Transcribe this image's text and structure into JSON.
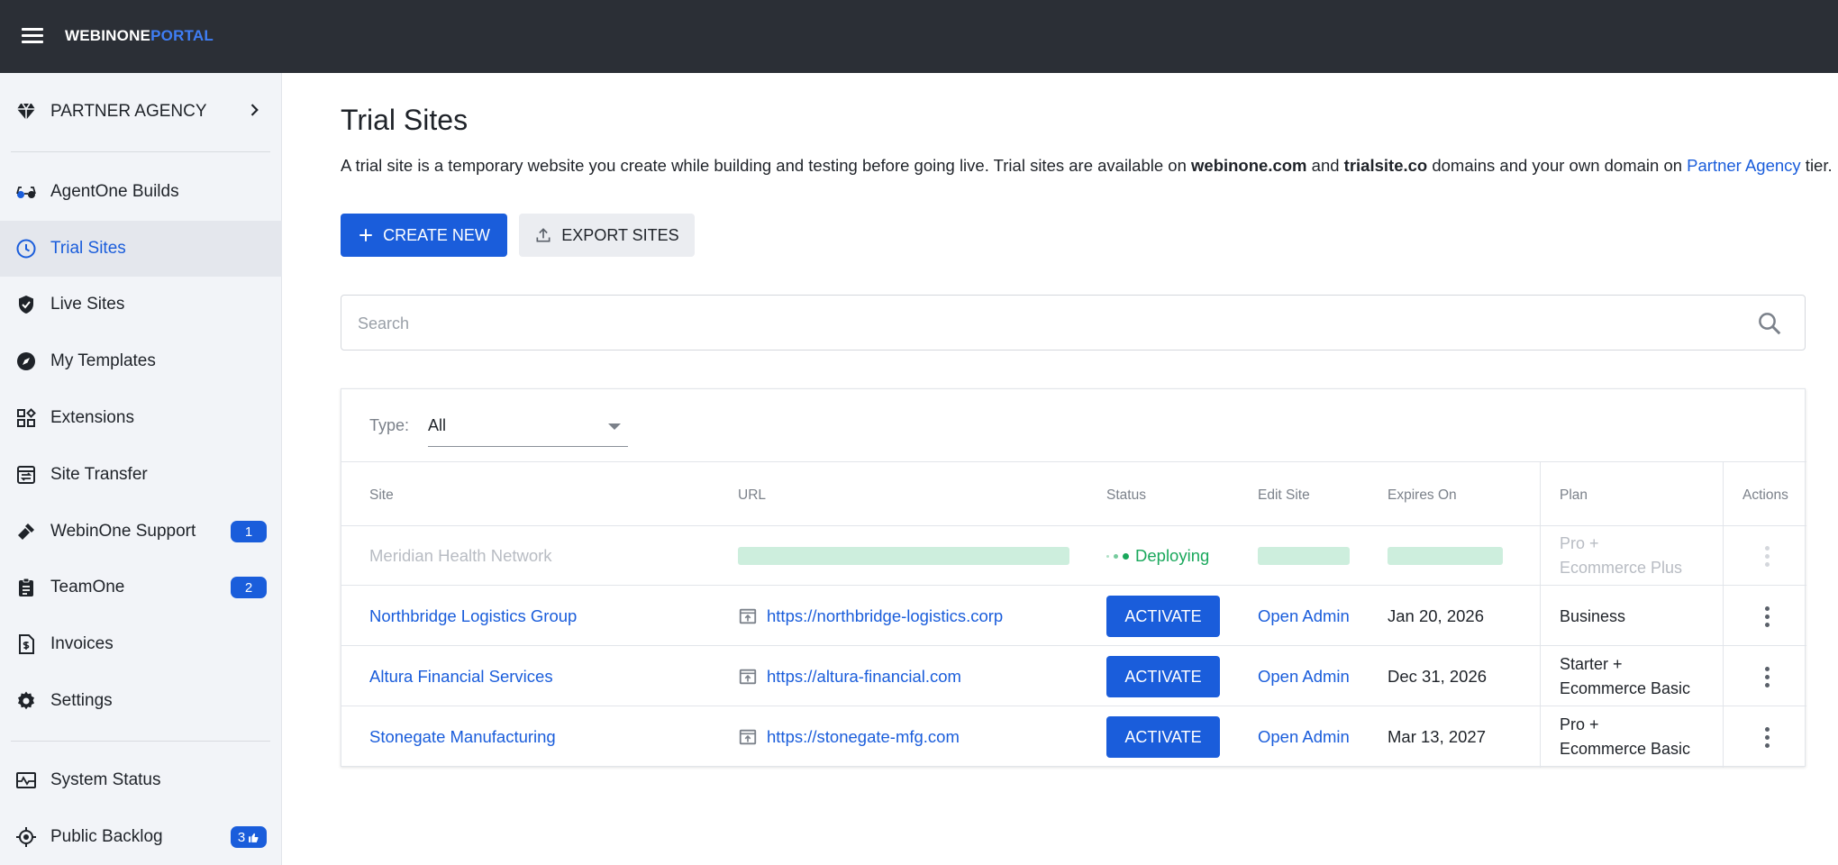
{
  "topbar": {
    "logo_main": "WEBINONE",
    "logo_accent": "PORTAL",
    "accent_color": "#3f7ef5",
    "bg_color": "#2b2f36"
  },
  "sidebar": {
    "header_item": {
      "label": "PARTNER AGENCY",
      "icon": "diamond-icon"
    },
    "items": [
      {
        "label": "AgentOne Builds",
        "icon": "glasses-icon"
      },
      {
        "label": "Trial Sites",
        "icon": "clock-icon",
        "active": true
      },
      {
        "label": "Live Sites",
        "icon": "shield-check-icon"
      },
      {
        "label": "My Templates",
        "icon": "compass-icon"
      },
      {
        "label": "Extensions",
        "icon": "widgets-icon"
      },
      {
        "label": "Site Transfer",
        "icon": "transfer-icon"
      },
      {
        "label": "WebinOne Support",
        "icon": "tools-icon",
        "badge": "1"
      },
      {
        "label": "TeamOne",
        "icon": "clipboard-icon",
        "badge": "2"
      },
      {
        "label": "Invoices",
        "icon": "invoice-icon"
      },
      {
        "label": "Settings",
        "icon": "gear-icon"
      }
    ],
    "footer_items": [
      {
        "label": "System Status",
        "icon": "status-chart-icon"
      },
      {
        "label": "Public Backlog",
        "icon": "target-icon",
        "badge": "3"
      }
    ]
  },
  "page": {
    "title": "Trial Sites",
    "intro": {
      "part1": "A trial site is a temporary website you create while building and testing before going live. Trial sites are available on ",
      "domain1": "webinone.com",
      "part2": " and ",
      "domain2": "trialsite.co",
      "part3": " domains and your own domain on ",
      "link": "Partner Agency",
      "part4": " tier."
    },
    "create_button": "CREATE NEW",
    "export_button": "EXPORT SITES",
    "search_placeholder": "Search"
  },
  "filter": {
    "label": "Type:",
    "value": "All"
  },
  "table": {
    "headers": {
      "site": "Site",
      "url": "URL",
      "status": "Status",
      "edit": "Edit Site",
      "expires": "Expires On",
      "plan": "Plan",
      "actions": "Actions"
    },
    "rows": [
      {
        "site": "Meridian Health Network",
        "url": "",
        "status": "Deploying",
        "edit": "",
        "expires": "",
        "plan_line1": "Pro +",
        "plan_line2": "Ecommerce Plus",
        "pending": true
      },
      {
        "site": "Northbridge Logistics Group",
        "url": "https://northbridge-logistics.corp",
        "status": "ACTIVATE",
        "edit": "Open Admin",
        "expires": "Jan 20, 2026",
        "plan_line1": "Business",
        "plan_line2": ""
      },
      {
        "site": "Altura Financial Services",
        "url": "https://altura-financial.com",
        "status": "ACTIVATE",
        "edit": "Open Admin",
        "expires": "Dec 31, 2026",
        "plan_line1": "Starter +",
        "plan_line2": "Ecommerce Basic"
      },
      {
        "site": "Stonegate Manufacturing",
        "url": "https://stonegate-mfg.com",
        "status": "ACTIVATE",
        "edit": "Open Admin",
        "expires": "Mar 13, 2027",
        "plan_line1": "Pro +",
        "plan_line2": "Ecommerce Basic"
      }
    ]
  },
  "colors": {
    "primary": "#1a5ddb",
    "deploying": "#1aa85c",
    "sidebar_bg": "#f2f4f8"
  }
}
